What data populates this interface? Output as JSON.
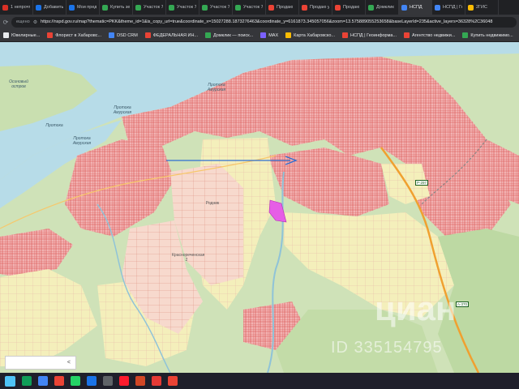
{
  "browser": {
    "tabs": [
      {
        "label": "1 непрочт",
        "color": "#d93025"
      },
      {
        "label": "Добавить",
        "color": "#1a73e8"
      },
      {
        "label": "Мои пред",
        "color": "#1a73e8"
      },
      {
        "label": "Купить зе",
        "color": "#34a853"
      },
      {
        "label": "Участок 7",
        "color": "#34a853"
      },
      {
        "label": "Участок 7",
        "color": "#34a853"
      },
      {
        "label": "Участок 7",
        "color": "#34a853"
      },
      {
        "label": "Участок 7",
        "color": "#34a853"
      },
      {
        "label": "Продаю",
        "color": "#ea4335"
      },
      {
        "label": "Продаю у",
        "color": "#ea4335"
      },
      {
        "label": "Продаю",
        "color": "#ea4335"
      },
      {
        "label": "Домклик",
        "color": "#34a853"
      },
      {
        "label": "НСПД",
        "color": "#4285f4",
        "active": true
      },
      {
        "label": "НСПД | Ге",
        "color": "#4285f4"
      },
      {
        "label": "2ГИС",
        "color": "#fbbc04"
      }
    ],
    "url": "https://nspd.gov.ru/map?thematic=PKK&theme_id=1&is_copy_url=true&coordinate_x=15027288.1873276463&coordinate_y=6161873.345057056&zoom=13.575889055253658&baseLayerId=235&active_layers=36328%2C36048",
    "url_prefix": "ещено",
    "bookmarks": [
      {
        "label": "Ювелирные...",
        "color": "#e8eaed"
      },
      {
        "label": "Флорист в Хабаровс...",
        "color": "#ea4335"
      },
      {
        "label": "DSD CRM",
        "color": "#4285f4"
      },
      {
        "label": "ФЕДЕРАЛЬНАЯ ИН...",
        "color": "#ea4335"
      },
      {
        "label": "Домклик — поиск...",
        "color": "#34a853"
      },
      {
        "label": "MAX",
        "color": "#7b61ff"
      },
      {
        "label": "Карта Хабаровско...",
        "color": "#fbbc04"
      },
      {
        "label": "НСПД | Геоинформа...",
        "color": "#ea4335"
      },
      {
        "label": "Агентство недвижи...",
        "color": "#ea4335"
      },
      {
        "label": "Купить недвижимо...",
        "color": "#34a853"
      }
    ]
  },
  "map": {
    "labels": {
      "island": "Осиновый остров",
      "strait1": "Протока Амурская",
      "strait2": "Протока Амурская",
      "strait3": "Протока Амурская",
      "river1": "Протока",
      "area_rodnik": "Родник",
      "area_south": "Краснореченская 2"
    },
    "roads": [
      "Р-297",
      "А-370"
    ],
    "zoom_control": "<",
    "watermark": [
      "циан",
      "ID 335154795"
    ]
  },
  "taskbar": {
    "icons": [
      {
        "name": "windows-start-icon",
        "color": "#4fc3f7"
      },
      {
        "name": "edge-icon",
        "color": "#0f9d58"
      },
      {
        "name": "file-explorer-icon",
        "color": "#4285f4"
      },
      {
        "name": "chrome-icon",
        "color": "#ea4335"
      },
      {
        "name": "whatsapp-icon",
        "color": "#25d366"
      },
      {
        "name": "mail-icon",
        "color": "#1a73e8"
      },
      {
        "name": "messenger-icon",
        "color": "#5f6368"
      },
      {
        "name": "opera-icon",
        "color": "#ff1b2d"
      },
      {
        "name": "powerpoint-icon",
        "color": "#d24726"
      },
      {
        "name": "pdf-icon",
        "color": "#e53935"
      },
      {
        "name": "chrome-profile-icon",
        "color": "#ea4335"
      }
    ]
  },
  "colors": {
    "river": "#b7dce8",
    "urban": "#f0a8a8",
    "agri": "#f3edb6",
    "forest": "#c7deb1",
    "highlight": "#e65ee6",
    "arrow": "#2e6fd1"
  }
}
